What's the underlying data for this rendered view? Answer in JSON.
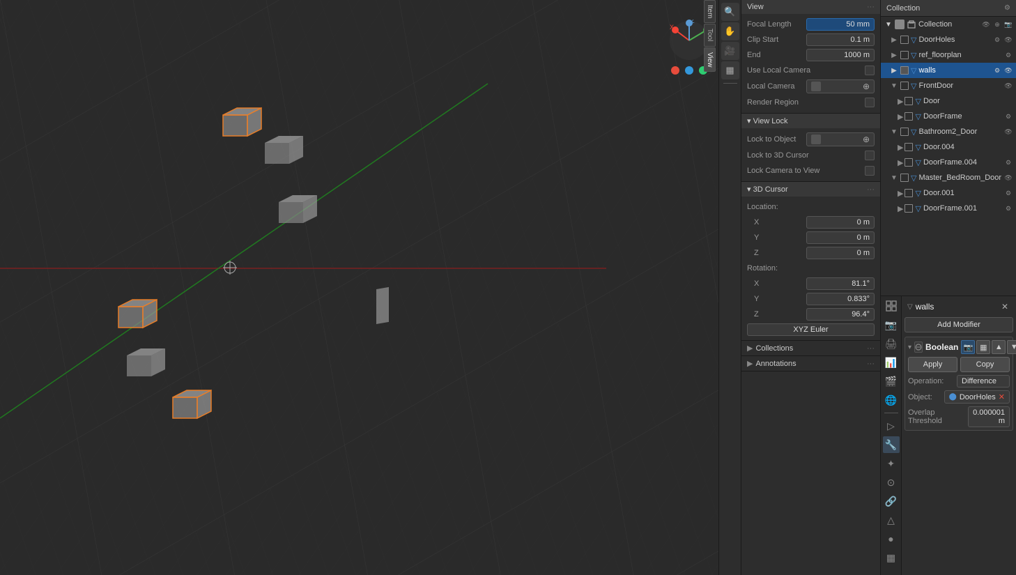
{
  "viewport": {
    "bg_color": "#2a2a2a"
  },
  "view_tabs": [
    "Item",
    "Tool",
    "View"
  ],
  "n_panel": {
    "sections": [
      {
        "title": "View",
        "fields": [
          {
            "label": "Focal Length",
            "value": "50 mm"
          },
          {
            "label": "Clip Start",
            "value": "0.1 m"
          },
          {
            "label": "End",
            "value": "1000 m"
          }
        ],
        "checkboxes": [
          {
            "label": "Use Local Camera",
            "checked": false
          },
          {
            "label": "Local Camera",
            "checked": false,
            "has_eyedropper": true
          }
        ],
        "button": "Render Region"
      },
      {
        "title": "View Lock",
        "checkboxes": [
          {
            "label": "Lock to Object",
            "has_field": true,
            "has_eyedropper": true
          },
          {
            "label": "Lock to 3D Cursor",
            "checked": false
          },
          {
            "label": "Lock Camera to View",
            "checked": false
          }
        ]
      },
      {
        "title": "3D Cursor",
        "location": {
          "x": "0 m",
          "y": "0 m",
          "z": "0 m"
        },
        "rotation": {
          "x": "81.1°",
          "y": "0.833°",
          "z": "96.4°"
        },
        "rotation_mode": "XYZ Euler"
      }
    ],
    "collections_section": {
      "title": "Collections",
      "collapsed": true
    },
    "annotations_section": {
      "title": "Annotations",
      "collapsed": true
    }
  },
  "outliner": {
    "title": "Collection",
    "items": [
      {
        "name": "Collection",
        "level": 0,
        "type": "collection",
        "icon": "▼"
      },
      {
        "name": "DoorHoles",
        "level": 1,
        "type": "object"
      },
      {
        "name": "ref_floorplan",
        "level": 1,
        "type": "object"
      },
      {
        "name": "walls",
        "level": 1,
        "type": "object",
        "selected": true
      },
      {
        "name": "FrontDoor",
        "level": 1,
        "type": "group"
      },
      {
        "name": "Door",
        "level": 2,
        "type": "object"
      },
      {
        "name": "DoorFrame",
        "level": 2,
        "type": "object"
      },
      {
        "name": "Bathroom2_Door",
        "level": 1,
        "type": "group"
      },
      {
        "name": "Door.004",
        "level": 2,
        "type": "object"
      },
      {
        "name": "DoorFrame.004",
        "level": 2,
        "type": "object"
      },
      {
        "name": "Master_BedRoom_Door",
        "level": 1,
        "type": "group"
      },
      {
        "name": "Door.001",
        "level": 2,
        "type": "object"
      },
      {
        "name": "DoorFrame.001",
        "level": 2,
        "type": "object"
      }
    ]
  },
  "properties_panel": {
    "object_name": "walls",
    "add_modifier_label": "Add Modifier",
    "modifier": {
      "name": "Boolean",
      "apply_label": "Apply",
      "copy_label": "Copy",
      "operation_label": "Operation:",
      "operation_value": "Difference",
      "object_label": "Object:",
      "object_value": "DoorHoles",
      "overlap_label": "Overlap Threshold",
      "overlap_value": "0.000001 m"
    }
  },
  "icons": {
    "search": "🔍",
    "hand": "✋",
    "camera": "📷",
    "grid": "▦",
    "cursor": "⊕",
    "eye": "👁",
    "wrench": "🔧",
    "chain": "🔗",
    "sphere": "⬤",
    "constraint": "🔒",
    "particle": "✦",
    "data": "△",
    "material": "●",
    "object": "▷",
    "scene": "🎬",
    "world": "🌐",
    "render": "📷"
  }
}
